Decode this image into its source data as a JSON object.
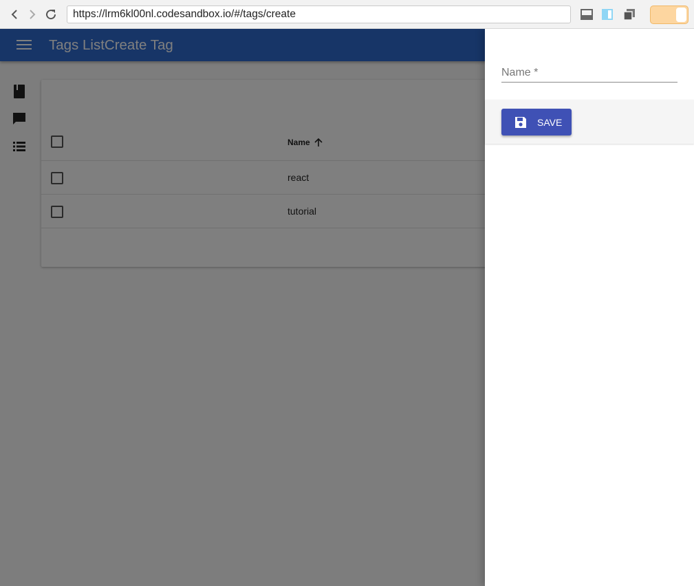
{
  "browser": {
    "url": "https://lrm6kl00nl.codesandbox.io/#/tags/create"
  },
  "app": {
    "title": "Tags ListCreate Tag",
    "accent_color": "#2f6bcf"
  },
  "sidebar": {
    "items": [
      {
        "icon": "book-icon"
      },
      {
        "icon": "comment-icon"
      },
      {
        "icon": "list-icon"
      }
    ]
  },
  "list": {
    "columns": [
      {
        "label": "Name",
        "sort": "ascending"
      }
    ],
    "rows": [
      {
        "name": "react"
      },
      {
        "name": "tutorial"
      }
    ]
  },
  "drawer": {
    "name_label": "Name *",
    "name_value": "",
    "save_label": "SAVE",
    "save_color": "#3f51b5"
  }
}
